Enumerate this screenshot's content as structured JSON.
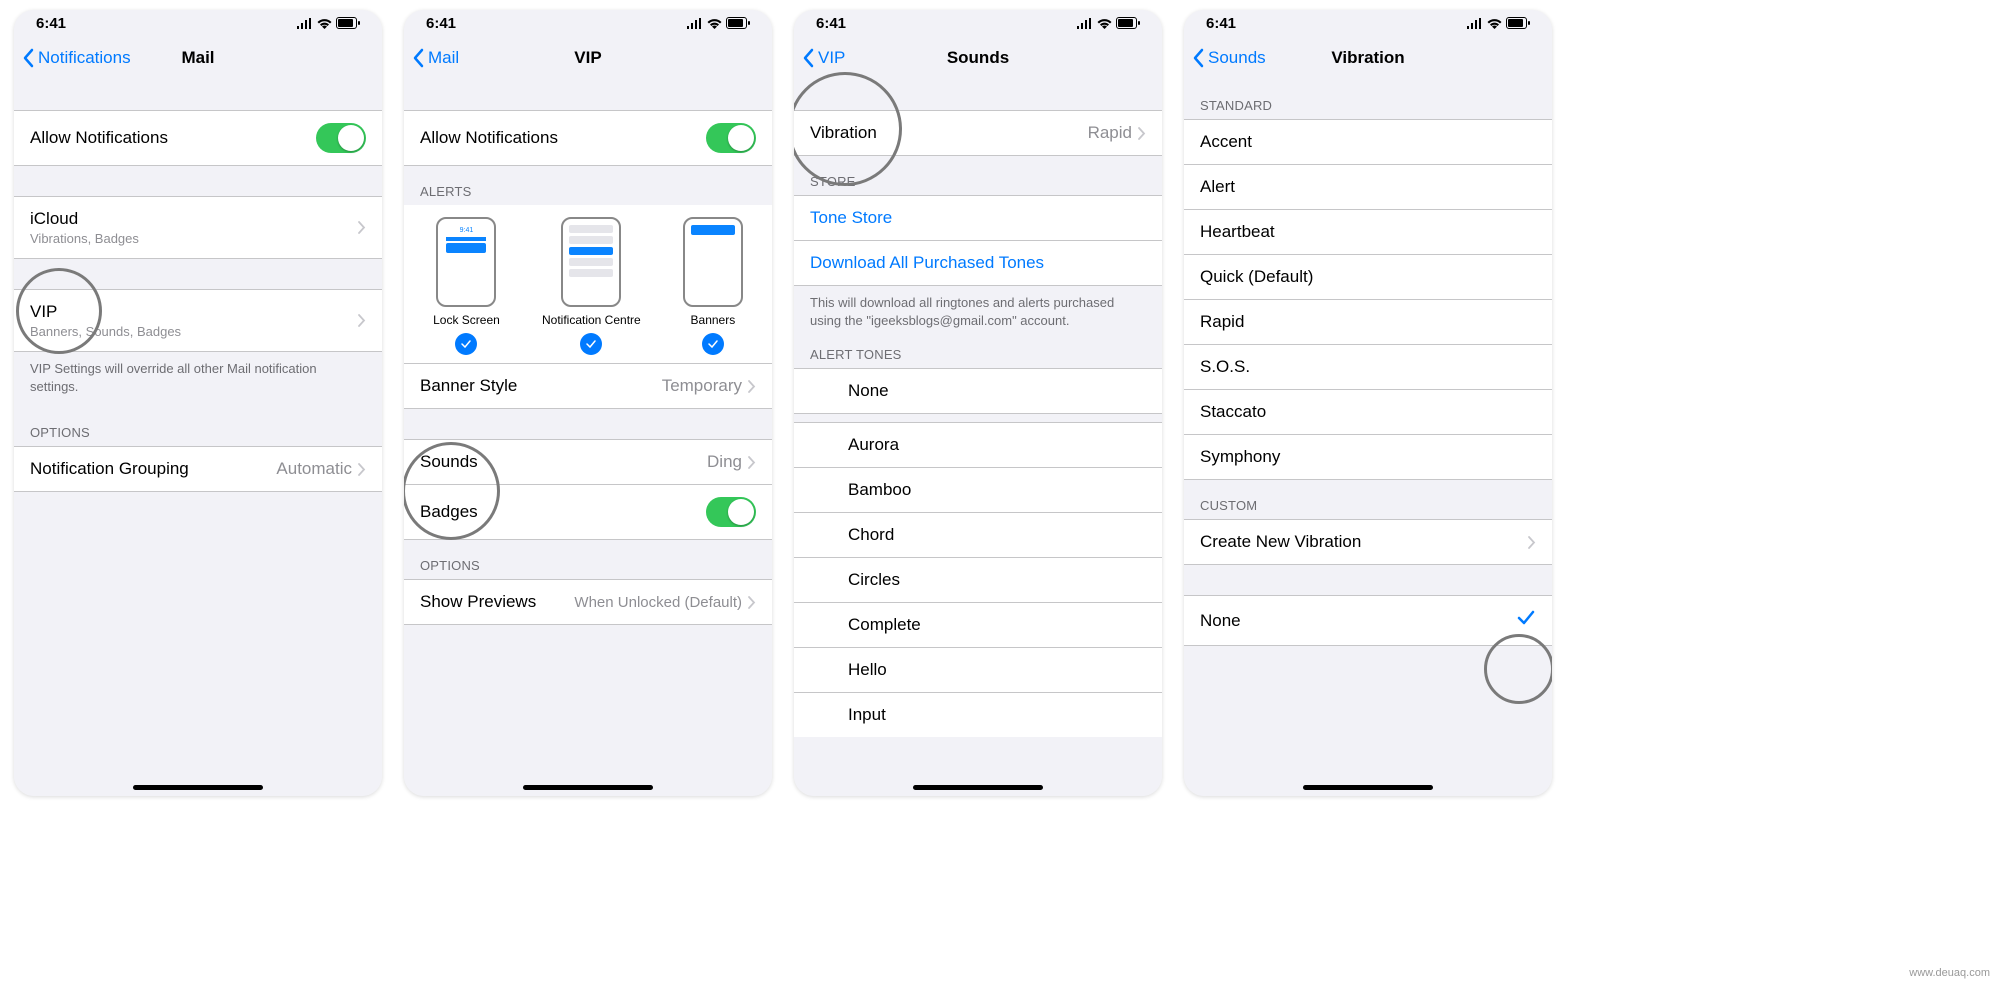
{
  "status": {
    "time": "6:41"
  },
  "screen1": {
    "back": "Notifications",
    "title": "Mail",
    "allow": "Allow Notifications",
    "icloud": {
      "title": "iCloud",
      "sub": "Vibrations, Badges"
    },
    "vip": {
      "title": "VIP",
      "sub": "Banners, Sounds, Badges"
    },
    "vip_footer": "VIP Settings will override all other Mail notification settings.",
    "options_header": "OPTIONS",
    "grouping": {
      "label": "Notification Grouping",
      "value": "Automatic"
    }
  },
  "screen2": {
    "back": "Mail",
    "title": "VIP",
    "allow": "Allow Notifications",
    "alerts_header": "ALERTS",
    "alert_labels": {
      "lock": "Lock Screen",
      "nc": "Notification Centre",
      "banner": "Banners"
    },
    "banner_style": {
      "label": "Banner Style",
      "value": "Temporary"
    },
    "sounds": {
      "label": "Sounds",
      "value": "Ding"
    },
    "badges": "Badges",
    "options_header": "OPTIONS",
    "previews": {
      "label": "Show Previews",
      "value": "When Unlocked (Default)"
    }
  },
  "screen3": {
    "back": "VIP",
    "title": "Sounds",
    "vibration": {
      "label": "Vibration",
      "value": "Rapid"
    },
    "store_header": "STORE",
    "tone_store": "Tone Store",
    "download_all": "Download All Purchased Tones",
    "download_footer": "This will download all ringtones and alerts purchased using the \"igeeksblogs@gmail.com\" account.",
    "alert_tones_header": "ALERT TONES",
    "tones": [
      "None",
      "Aurora",
      "Bamboo",
      "Chord",
      "Circles",
      "Complete",
      "Hello",
      "Input"
    ]
  },
  "screen4": {
    "back": "Sounds",
    "title": "Vibration",
    "standard_header": "STANDARD",
    "standard": [
      "Accent",
      "Alert",
      "Heartbeat",
      "Quick (Default)",
      "Rapid",
      "S.O.S.",
      "Staccato",
      "Symphony"
    ],
    "custom_header": "CUSTOM",
    "create_new": "Create New Vibration",
    "none": "None"
  },
  "watermark": "www.deuaq.com"
}
